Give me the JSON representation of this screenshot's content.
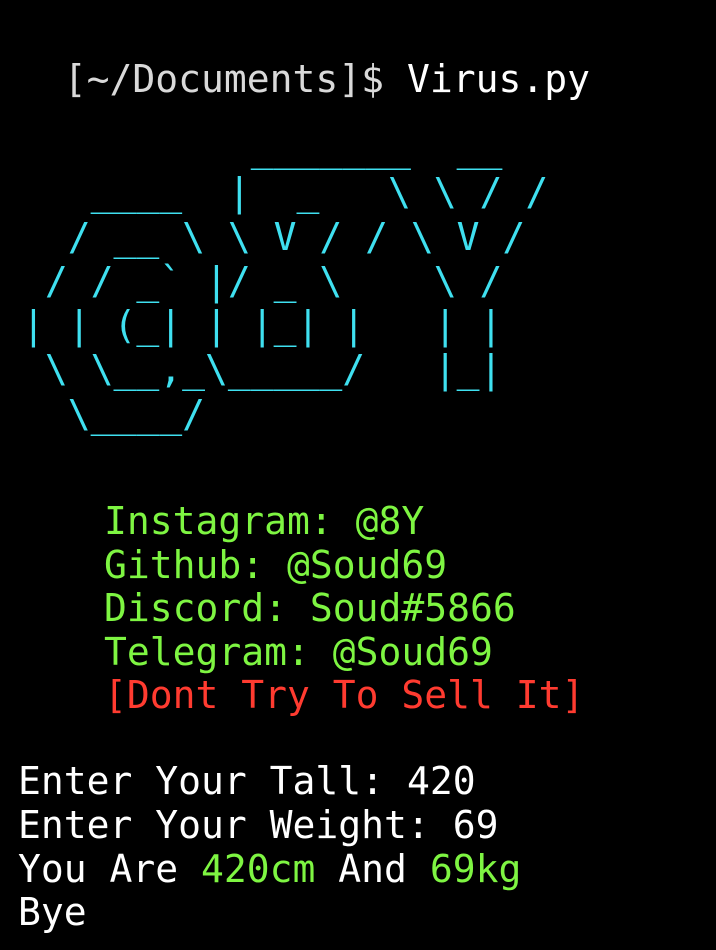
{
  "terminal": {
    "prompt_path": "[~/Documents]$",
    "command": "Virus.py"
  },
  "banner": {
    "ascii_art": "          _______  __\n   ____  |  _   \\ \\ / /\n  / __ \\ \\ V / / \\ V /\n / / _` |/ _ \\    \\ /\n| | (_| | |_| |   | |\n \\ \\__,_\\_____/   |_|\n  \\____/",
    "color": "#3fe0f0"
  },
  "info": {
    "instagram": "Instagram: @8Y",
    "github": "Github: @Soud69",
    "discord": "Discord: Soud#5866",
    "telegram": "Telegram: @Soud69",
    "warning": "[Dont Try To Sell It]"
  },
  "output": {
    "tall_prompt": "Enter Your Tall: ",
    "tall_value": "420",
    "weight_prompt": "Enter Your Weight: ",
    "weight_value": "69",
    "result_prefix": "You Are ",
    "result_height": "420cm",
    "result_and": " And ",
    "result_weight": "69kg",
    "bye": "Bye"
  },
  "colors": {
    "background": "#000000",
    "text": "#ffffff",
    "banner": "#3fe0f0",
    "info": "#7ef542",
    "warning": "#ff3b30"
  }
}
